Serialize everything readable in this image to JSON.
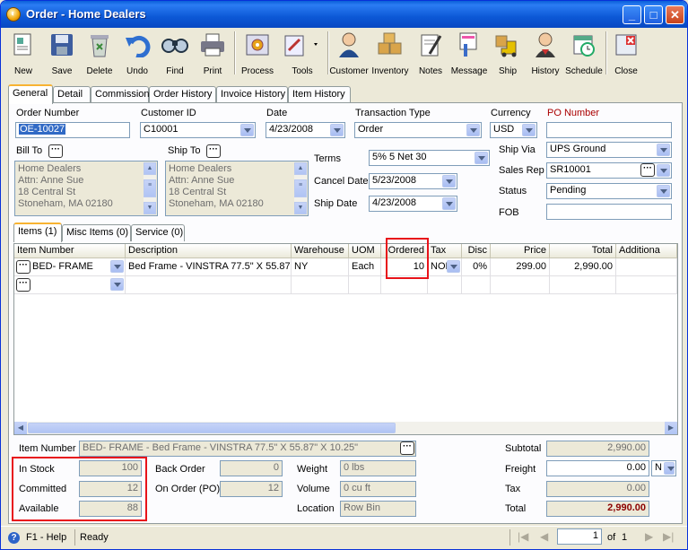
{
  "window": {
    "title": "Order - Home Dealers"
  },
  "toolbar": [
    {
      "label": "New",
      "icon": "new-icon"
    },
    {
      "label": "Save",
      "icon": "save-icon"
    },
    {
      "label": "Delete",
      "icon": "delete-icon"
    },
    {
      "label": "Undo",
      "icon": "undo-icon"
    },
    {
      "label": "Find",
      "icon": "find-icon"
    },
    {
      "label": "Print",
      "icon": "print-icon"
    },
    {
      "label": "Process",
      "icon": "process-icon"
    },
    {
      "label": "Tools",
      "icon": "tools-icon"
    },
    {
      "label": "Customer",
      "icon": "customer-icon"
    },
    {
      "label": "Inventory",
      "icon": "inventory-icon"
    },
    {
      "label": "Notes",
      "icon": "notes-icon"
    },
    {
      "label": "Message",
      "icon": "message-icon"
    },
    {
      "label": "Ship",
      "icon": "ship-icon"
    },
    {
      "label": "History",
      "icon": "history-icon"
    },
    {
      "label": "Schedule",
      "icon": "schedule-icon"
    },
    {
      "label": "Close",
      "icon": "close-icon"
    }
  ],
  "tabs": [
    "General",
    "Detail",
    "Commission",
    "Order History",
    "Invoice History",
    "Item History"
  ],
  "form": {
    "order_number_label": "Order Number",
    "order_number": "OE-10027",
    "customer_id_label": "Customer ID",
    "customer_id": "C10001",
    "date_label": "Date",
    "date": "4/23/2008",
    "transaction_type_label": "Transaction Type",
    "transaction_type": "Order",
    "currency_label": "Currency",
    "currency": "USD",
    "po_number_label": "PO Number",
    "po_number": "",
    "bill_to_label": "Bill To",
    "ship_to_label": "Ship To",
    "bill_to": [
      "Home Dealers",
      "Attn: Anne Sue",
      "18 Central St",
      "Stoneham, MA 02180"
    ],
    "ship_to": [
      "Home Dealers",
      "Attn: Anne Sue",
      "18 Central St",
      "Stoneham, MA 02180"
    ],
    "terms_label": "Terms",
    "terms": "5% 5 Net 30",
    "cancel_date_label": "Cancel Date",
    "cancel_date": "5/23/2008",
    "ship_date_label": "Ship Date",
    "ship_date": "4/23/2008",
    "ship_via_label": "Ship Via",
    "ship_via": "UPS Ground",
    "sales_rep_label": "Sales Rep",
    "sales_rep": "SR10001",
    "status_label": "Status",
    "status": "Pending",
    "fob_label": "FOB",
    "fob": ""
  },
  "subtabs": [
    "Items (1)",
    "Misc Items (0)",
    "Service (0)"
  ],
  "grid": {
    "columns": [
      "Item Number",
      "Description",
      "Warehouse",
      "UOM",
      "Ordered",
      "Tax",
      "Disc",
      "Price",
      "Total",
      "Additiona"
    ],
    "rows": [
      {
        "item": "BED- FRAME",
        "description": "Bed Frame - VINSTRA 77.5\" X 55.87\"",
        "warehouse": "NY",
        "uom": "Each",
        "ordered": "10",
        "tax": "NON",
        "disc": "0%",
        "price": "299.00",
        "total": "2,990.00"
      }
    ]
  },
  "bottom": {
    "item_number_label": "Item Number",
    "item_number": "BED- FRAME - Bed Frame - VINSTRA 77.5\" X 55.87\" X 10.25\"",
    "in_stock_label": "In Stock",
    "in_stock": "100",
    "committed_label": "Committed",
    "committed": "12",
    "available_label": "Available",
    "available": "88",
    "back_order_label": "Back Order",
    "back_order": "0",
    "on_order_label": "On Order (PO)",
    "on_order": "12",
    "weight_label": "Weight",
    "weight": "0 lbs",
    "volume_label": "Volume",
    "volume": "0 cu ft",
    "location_label": "Location",
    "location": "Row Bin",
    "subtotal_label": "Subtotal",
    "subtotal": "2,990.00",
    "freight_label": "Freight",
    "freight": "0.00",
    "freight_code": "N",
    "tax_label": "Tax",
    "tax": "0.00",
    "total_label": "Total",
    "total": "2,990.00"
  },
  "statusbar": {
    "help": "F1 - Help",
    "state": "Ready",
    "page": "1",
    "of": "of",
    "pages": "1"
  }
}
